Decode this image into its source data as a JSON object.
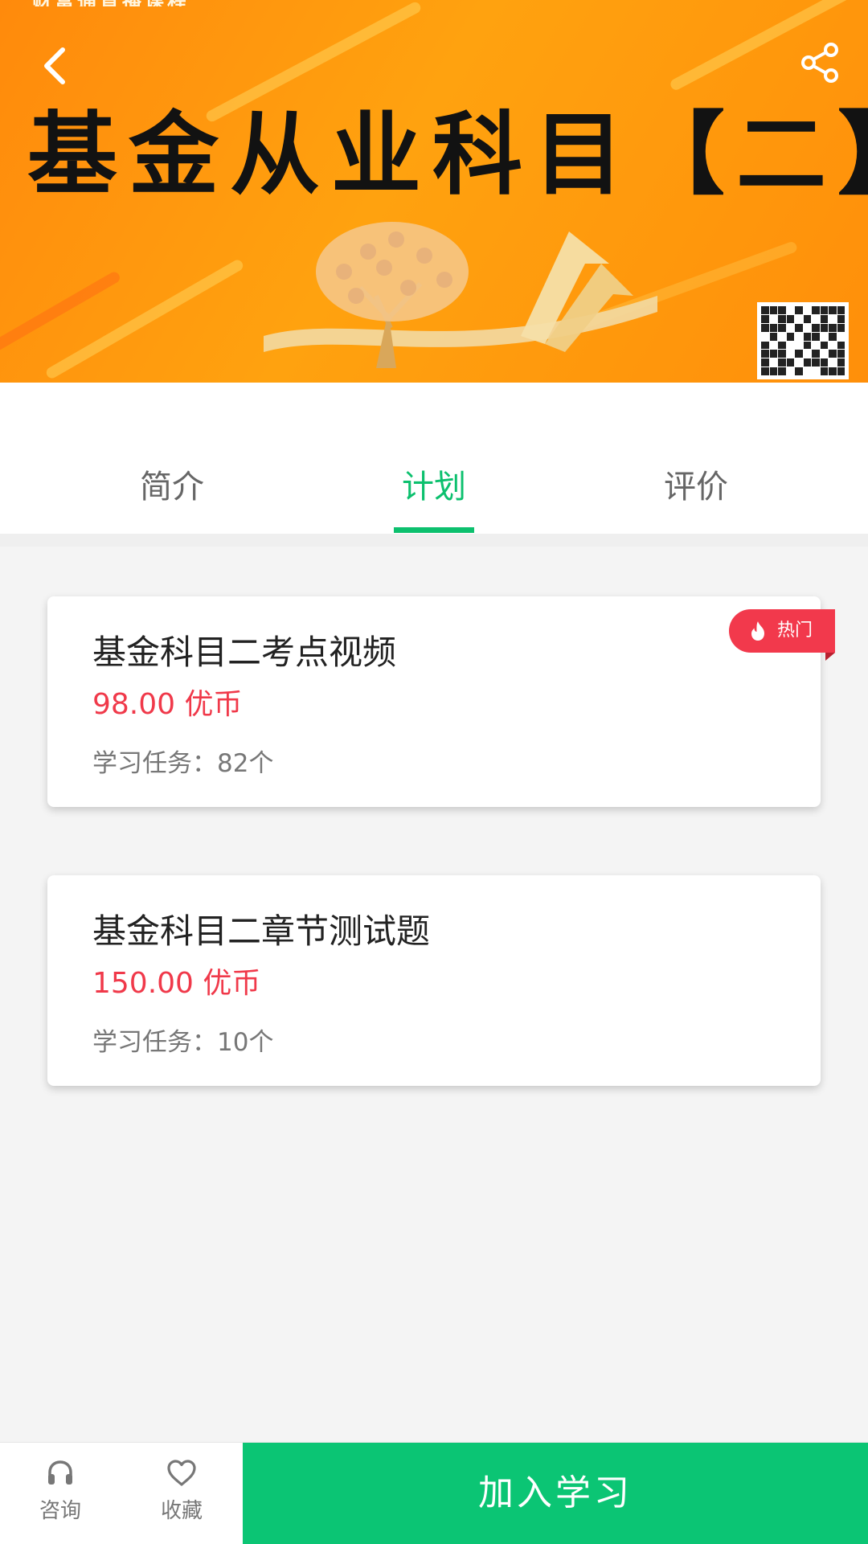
{
  "banner": {
    "top_text": "财富通直播课程",
    "title": "基金从业科目【二】",
    "colors": {
      "background": "#ff9a0d",
      "title": "#121212"
    }
  },
  "icons": {
    "back": "back-arrow-icon",
    "share": "share-icon",
    "hot": "flame-icon",
    "consult": "headset-icon",
    "favorite": "heart-icon"
  },
  "tabs": [
    {
      "label": "简介",
      "active": false
    },
    {
      "label": "计划",
      "active": true
    },
    {
      "label": "评价",
      "active": false
    }
  ],
  "plans": [
    {
      "title": "基金科目二考点视频",
      "price": "98.00 优币",
      "tasks": "学习任务：82个",
      "badge": "热门"
    },
    {
      "title": "基金科目二章节测试题",
      "price": "150.00 优币",
      "tasks": "学习任务：10个"
    }
  ],
  "bottom_bar": {
    "consult_label": "咨询",
    "favorite_label": "收藏",
    "join_label": "加入学习"
  },
  "colors": {
    "accent": "#0bc574",
    "price": "#f0394a",
    "badge": "#f2394c"
  }
}
